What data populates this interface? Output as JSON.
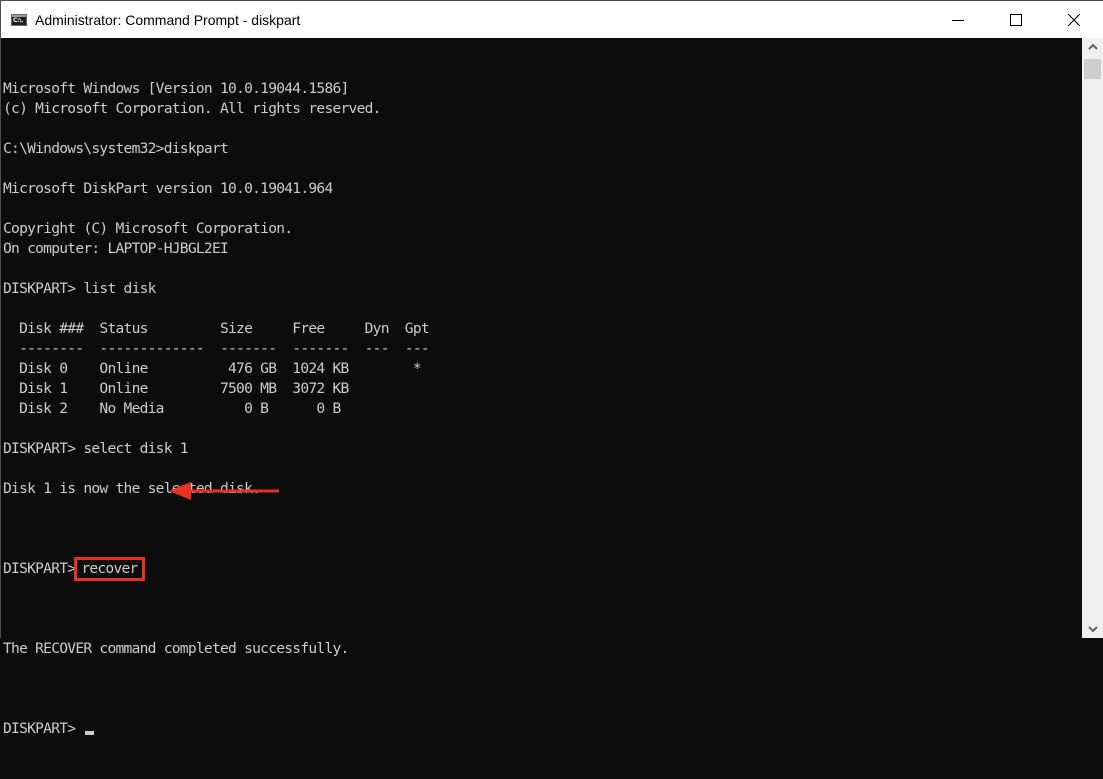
{
  "window": {
    "title": "Administrator: Command Prompt - diskpart",
    "icon": "cmd-icon",
    "icon_label": "C:\\.",
    "controls": [
      "minimize",
      "maximize",
      "close"
    ]
  },
  "console": {
    "lines": [
      "Microsoft Windows [Version 10.0.19044.1586]",
      "(c) Microsoft Corporation. All rights reserved.",
      "",
      "C:\\Windows\\system32>diskpart",
      "",
      "Microsoft DiskPart version 10.0.19041.964",
      "",
      "Copyright (C) Microsoft Corporation.",
      "On computer: LAPTOP-HJBGL2EI",
      "",
      "DISKPART> list disk",
      "",
      "  Disk ###  Status         Size     Free     Dyn  Gpt",
      "  --------  -------------  -------  -------  ---  ---",
      "  Disk 0    Online          476 GB  1024 KB        *",
      "  Disk 1    Online         7500 MB  3072 KB",
      "  Disk 2    No Media          0 B      0 B",
      "",
      "DISKPART> select disk 1",
      "",
      "Disk 1 is now the selected disk.",
      ""
    ],
    "highlighted_prompt": "DISKPART>",
    "highlighted_command": "recover",
    "after_lines": [
      "",
      "The RECOVER command completed successfully.",
      ""
    ],
    "final_prompt": "DISKPART> "
  },
  "disk_table": {
    "columns": [
      "Disk ###",
      "Status",
      "Size",
      "Free",
      "Dyn",
      "Gpt"
    ],
    "rows": [
      [
        "Disk 0",
        "Online",
        "476 GB",
        "1024 KB",
        "",
        "*"
      ],
      [
        "Disk 1",
        "Online",
        "7500 MB",
        "3072 KB",
        "",
        ""
      ],
      [
        "Disk 2",
        "No Media",
        "0 B",
        "0 B",
        "",
        ""
      ]
    ]
  },
  "annotation": {
    "color": "#e8321e",
    "type": "highlight-box-with-arrow",
    "target": "recover"
  },
  "colors": {
    "console_bg": "#0c0c0c",
    "console_fg": "#cccccc",
    "titlebar_bg": "#ffffff",
    "scrollbar_bg": "#f0f0f0"
  }
}
